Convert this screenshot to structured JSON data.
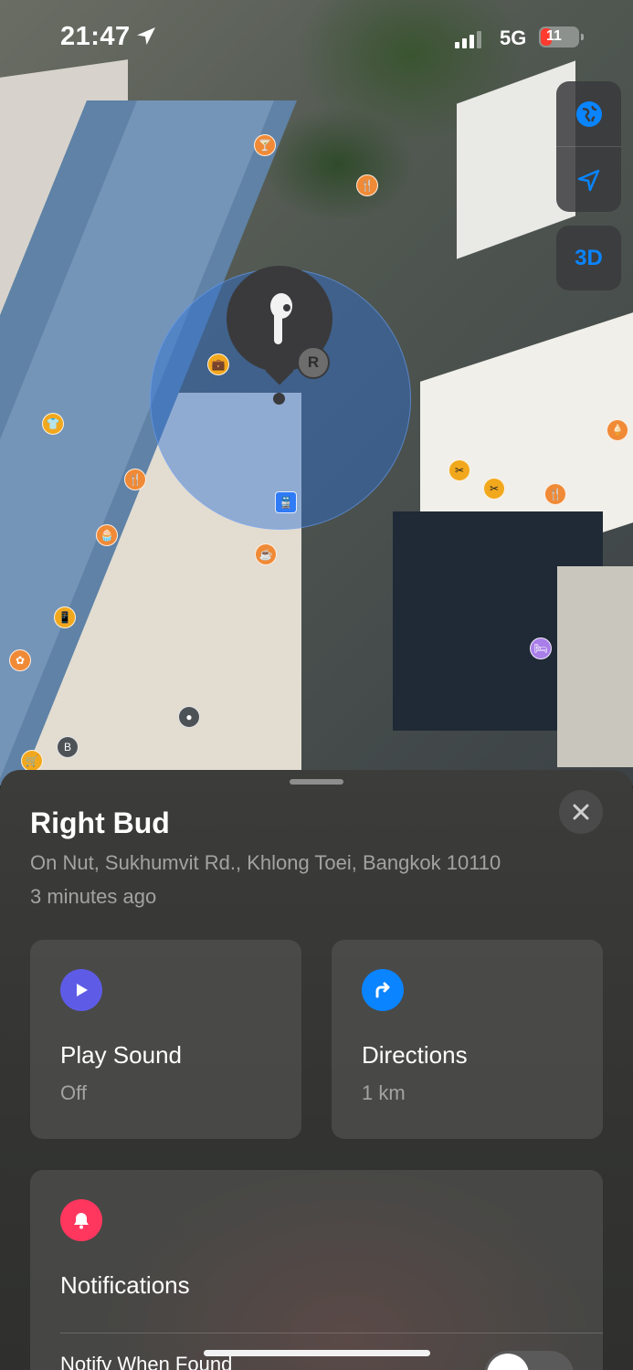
{
  "status_bar": {
    "time": "21:47",
    "network": "5G",
    "battery": "11"
  },
  "map": {
    "controls": {
      "three_d_label": "3D"
    },
    "marker": {
      "icon": "airpod-icon",
      "badge": "R"
    },
    "pois": [
      "bar",
      "restaurant",
      "restaurant",
      "office",
      "clothing",
      "restaurant",
      "bakery",
      "coffee",
      "phone",
      "beauty",
      "shopping-cart",
      "bank",
      "transit-dot",
      "train",
      "ice-cream",
      "beauty-salon",
      "beauty-salon",
      "restaurant",
      "hotel"
    ]
  },
  "sheet": {
    "title": "Right Bud",
    "address": "On Nut, Sukhumvit Rd., Khlong Toei, Bangkok 10110",
    "updated": "3 minutes ago",
    "play_sound": {
      "label": "Play Sound",
      "status": "Off",
      "color": "#5e5ce6"
    },
    "directions": {
      "label": "Directions",
      "distance": "1 km",
      "color": "#0a84ff"
    },
    "notifications": {
      "label": "Notifications",
      "color": "#ff375f",
      "row_label": "Notify When Found"
    }
  }
}
